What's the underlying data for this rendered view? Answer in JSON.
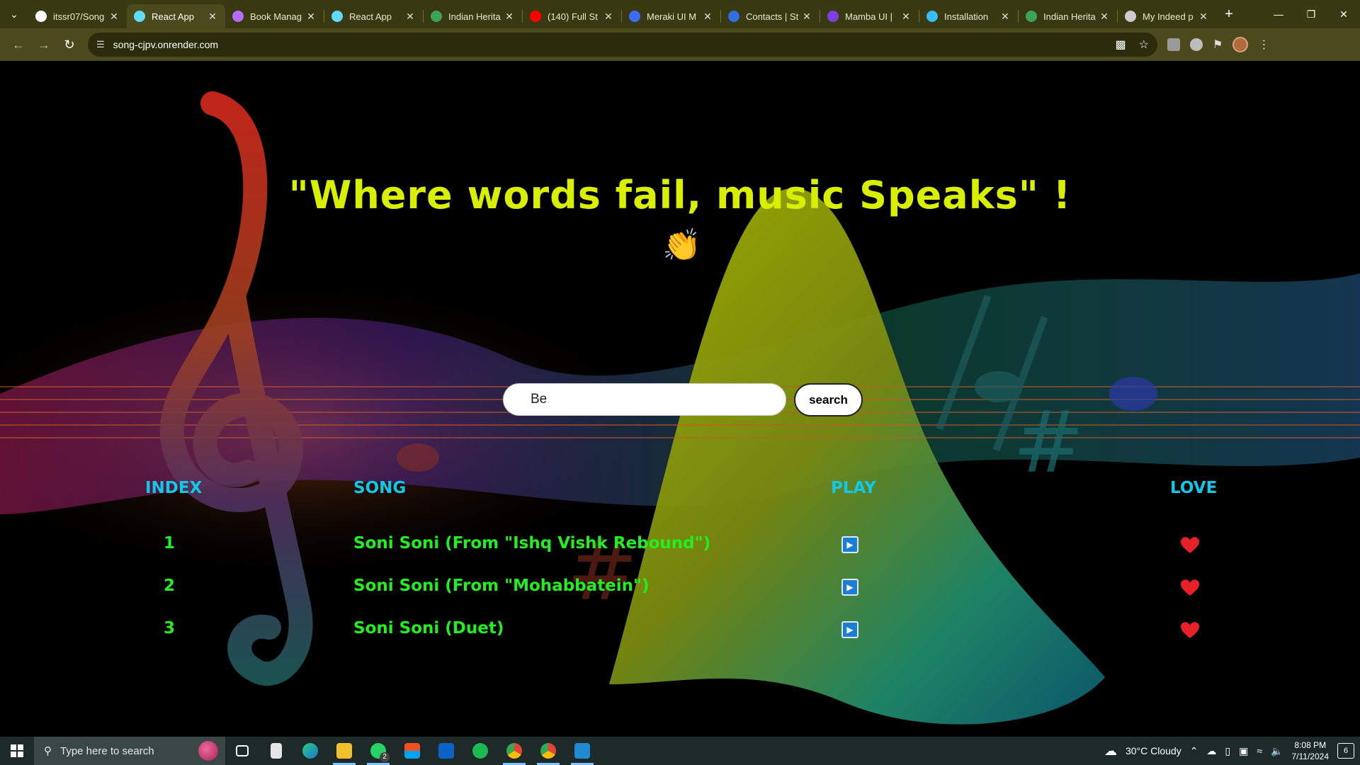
{
  "browser": {
    "tabs": [
      {
        "title": "itssr07/Song",
        "favicon": "github-icon",
        "color": "#ffffff"
      },
      {
        "title": "React App",
        "favicon": "react-icon",
        "color": "#61dafb",
        "active": true
      },
      {
        "title": "Book Manag",
        "favicon": "vite-icon",
        "color": "#b36cff"
      },
      {
        "title": "React App",
        "favicon": "react-icon",
        "color": "#61dafb"
      },
      {
        "title": "Indian Herita",
        "favicon": "globe-icon",
        "color": "#3aa35a"
      },
      {
        "title": "(140) Full St",
        "favicon": "youtube-icon",
        "color": "#ff0000"
      },
      {
        "title": "Meraki UI M",
        "favicon": "meraki-icon",
        "color": "#3b6cff"
      },
      {
        "title": "Contacts | St",
        "favicon": "contacts-icon",
        "color": "#2f6fe0"
      },
      {
        "title": "Mamba UI |",
        "favicon": "mamba-icon",
        "color": "#7b3fe4"
      },
      {
        "title": "Installation",
        "favicon": "tailwind-icon",
        "color": "#38bdf8"
      },
      {
        "title": "Indian Herita",
        "favicon": "globe-icon",
        "color": "#3aa35a"
      },
      {
        "title": "My Indeed p",
        "favicon": "indeed-icon",
        "color": "#cccccc"
      }
    ],
    "url": "song-cjpv.onrender.com"
  },
  "page": {
    "quote": "\"Where words fail, music Speaks\" !",
    "wave_emoji": "👏",
    "search": {
      "value": "Be",
      "button_label": "search"
    },
    "columns": {
      "index": "INDEX",
      "song": "SONG",
      "play": "PLAY",
      "love": "LOVE"
    },
    "songs": [
      {
        "index": "1",
        "title": "Soni Soni (From \"Ishq Vishk Rebound\")"
      },
      {
        "index": "2",
        "title": "Soni Soni (From \"Mohabbatein\")"
      },
      {
        "index": "3",
        "title": "Soni Soni (Duet)"
      }
    ],
    "colors": {
      "quote": "#d8f000",
      "header": "#10c8e8",
      "song_text": "#22ee22",
      "heart": "#e8202a",
      "play": "#1a7fd4"
    }
  },
  "taskbar": {
    "search_placeholder": "Type here to search",
    "weather": "30°C  Cloudy",
    "time": "8:08 PM",
    "date": "7/11/2024",
    "notification_count": "6",
    "whatsapp_badge": "2"
  }
}
